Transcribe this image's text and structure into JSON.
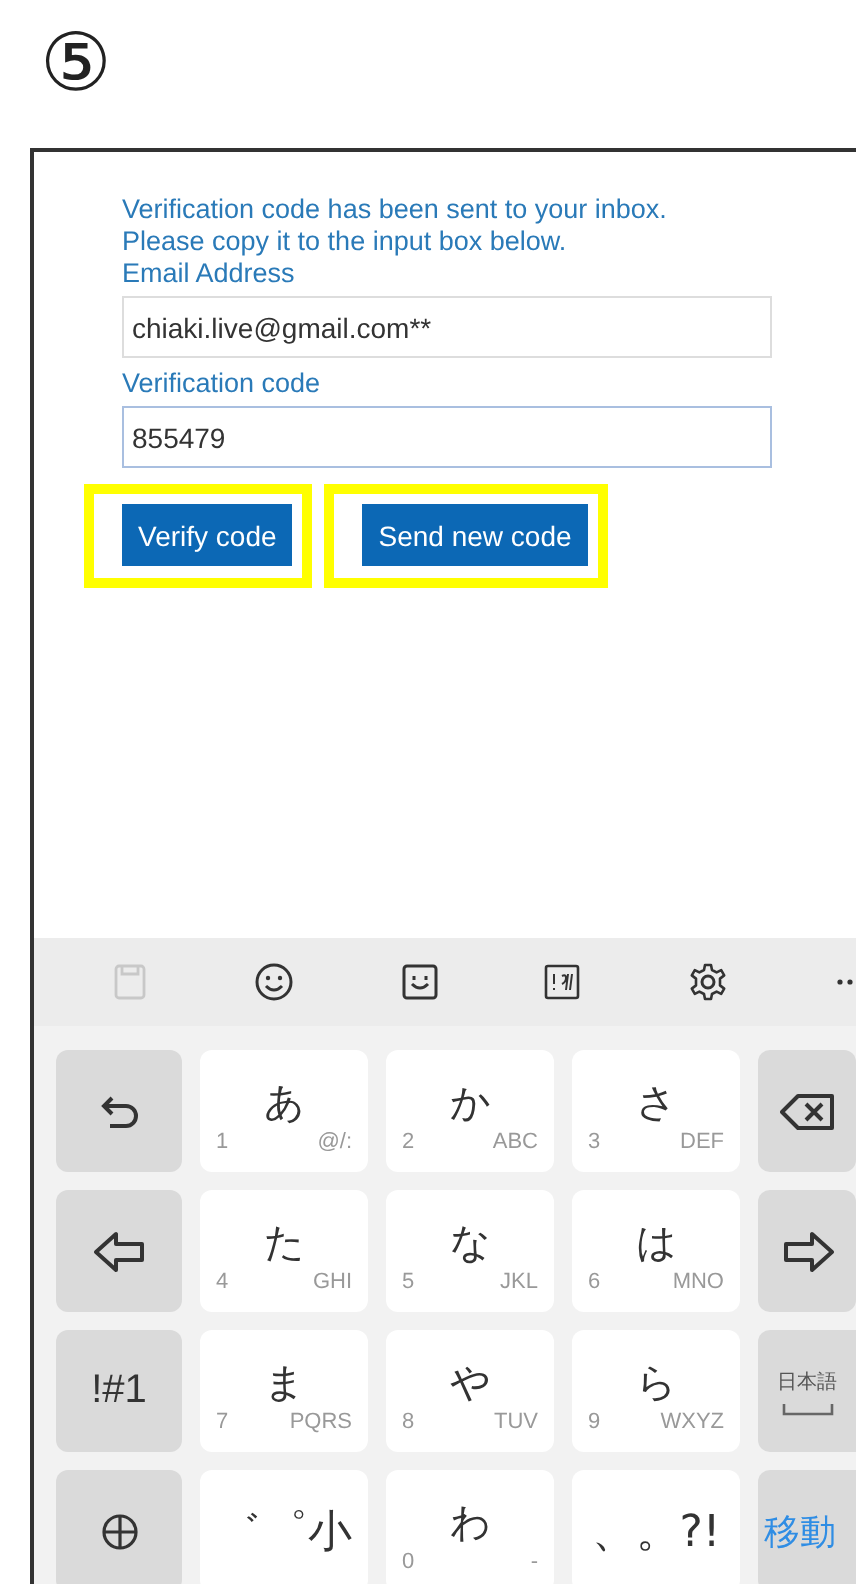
{
  "step_label": "⑤",
  "form": {
    "message": "Verification code has been sent to your inbox.\nPlease copy it to the input box below.",
    "email_label": "Email Address",
    "email_value": "chiaki.live@gmail.com**",
    "code_label": "Verification code",
    "code_value": "855479",
    "buttons": [
      {
        "label": "Verify code",
        "highlighted": true
      },
      {
        "label": "Send new code",
        "highlighted": true
      }
    ]
  },
  "keyboard": {
    "rows": [
      [
        {
          "kind": "undo"
        },
        {
          "kind": "kana",
          "main": "あ",
          "num": "1",
          "sub": "@/:"
        },
        {
          "kind": "kana",
          "main": "か",
          "num": "2",
          "sub": "ABC"
        },
        {
          "kind": "kana",
          "main": "さ",
          "num": "3",
          "sub": "DEF"
        },
        {
          "kind": "backspace"
        }
      ],
      [
        {
          "kind": "left"
        },
        {
          "kind": "kana",
          "main": "た",
          "num": "4",
          "sub": "GHI"
        },
        {
          "kind": "kana",
          "main": "な",
          "num": "5",
          "sub": "JKL"
        },
        {
          "kind": "kana",
          "main": "は",
          "num": "6",
          "sub": "MNO"
        },
        {
          "kind": "right"
        }
      ],
      [
        {
          "kind": "text",
          "label": "!#1"
        },
        {
          "kind": "kana",
          "main": "ま",
          "num": "7",
          "sub": "PQRS"
        },
        {
          "kind": "kana",
          "main": "や",
          "num": "8",
          "sub": "TUV"
        },
        {
          "kind": "kana",
          "main": "ら",
          "num": "9",
          "sub": "WXYZ"
        },
        {
          "kind": "space",
          "label": "日本語"
        }
      ],
      [
        {
          "kind": "globe"
        },
        {
          "kind": "big",
          "label": "゛゜小"
        },
        {
          "kind": "kana",
          "main": "わ",
          "num": "0",
          "sub": "-"
        },
        {
          "kind": "big",
          "label": "、。?!"
        },
        {
          "kind": "action",
          "label": "移動"
        }
      ]
    ]
  }
}
